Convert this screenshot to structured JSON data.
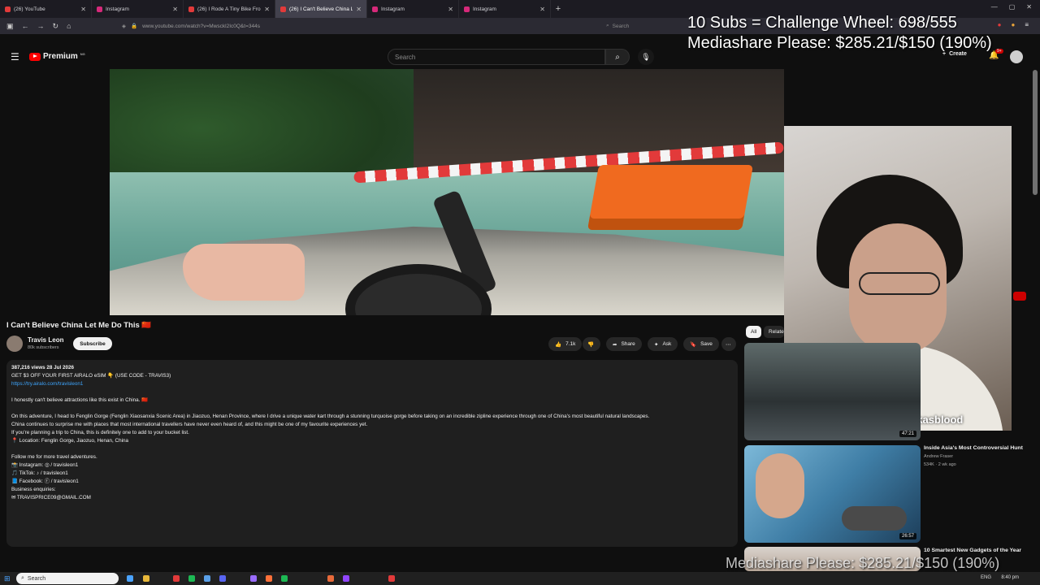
{
  "browser": {
    "tabs": [
      {
        "title": "(26) YouTube",
        "color": "#e23a3a"
      },
      {
        "title": "Instagram",
        "color": "#d6297a"
      },
      {
        "title": "(26) I Rode A Tiny Bike From Th",
        "color": "#e23a3a"
      },
      {
        "title": "(26) I Can't Believe China Let M",
        "color": "#e23a3a",
        "active": true
      },
      {
        "title": "Instagram",
        "color": "#d6297a"
      },
      {
        "title": "Instagram",
        "color": "#d6297a"
      }
    ],
    "url": "www.youtube.com/watch?v=Mwsckl2Ic0Q&t=344s",
    "search_placeholder": "Search"
  },
  "overlays": {
    "line1": "10 Subs = Challenge Wheel: 698/555",
    "line2": "Mediashare Please: $285.21/$150 (190%)",
    "line3": "Mediashare Please: $285.21/$150 (190%)"
  },
  "youtube": {
    "logo_text": "Premium",
    "logo_badge": "NG",
    "search_placeholder": "Search",
    "create_label": "Create",
    "notif_count": "9+"
  },
  "video": {
    "title": "I Can't Believe China Let Me Do This 🇨🇳",
    "channel": "Travis Leon",
    "subscribers": "80k subscribers",
    "subscribe_label": "Subscribe",
    "likes": "7.1k",
    "share_label": "Share",
    "ask_label": "Ask",
    "save_label": "Save"
  },
  "description": {
    "meta": "387,216 views  28 Jul 2026",
    "lines": [
      "GET $3 OFF YOUR FIRST AIRALO eSIM 👇 (USE CODE - TRAVIS3)",
      "https://try.airalo.com/travisleon1",
      "",
      "I honestly can't believe attractions like this exist in China. 🇨🇳",
      "",
      "On this adventure, I head to Fenglin Gorge (Fenglin Xiaosanxia Scenic Area) in Jiaozuo, Henan Province, where I drive a unique water kart through a stunning turquoise gorge before taking on an incredible zipline experience through one of China's most beautiful natural landscapes.",
      "China continues to surprise me with places that most international travellers have never even heard of, and this might be one of my favourite experiences yet.",
      "If you're planning a trip to China, this is definitely one to add to your bucket list.",
      "📍 Location: Fenglin Gorge, Jiaozuo, Henan, China",
      "",
      "Follow me for more travel adventures.",
      "📸 Instagram: ◎ / travisleon1",
      "🎵 TikTok: ♪ / travisleon1",
      "📘 Facebook: ⓕ / travisleon1",
      "Business enquiries:",
      "✉ TRAVISPRICE09@GMAIL.COM"
    ]
  },
  "sidebar": {
    "chips": [
      "All",
      "Relate"
    ],
    "videos": [
      {
        "title": "",
        "channel": "",
        "meta": "",
        "duration": "47:21"
      },
      {
        "title": "Inside Asia's Most Controversial Hunt",
        "channel": "Andrew Fraser",
        "meta": "534K · 2 wk ago",
        "duration": "26:57"
      },
      {
        "title": "10 Smartest New Gadgets of the Year",
        "channel": "",
        "meta": "",
        "duration": ""
      }
    ]
  },
  "webcam": {
    "handle": "◎🐦 sukasblood"
  },
  "taskbar": {
    "search_placeholder": "Search",
    "lang": "ENG",
    "time": "8:40 pm"
  }
}
